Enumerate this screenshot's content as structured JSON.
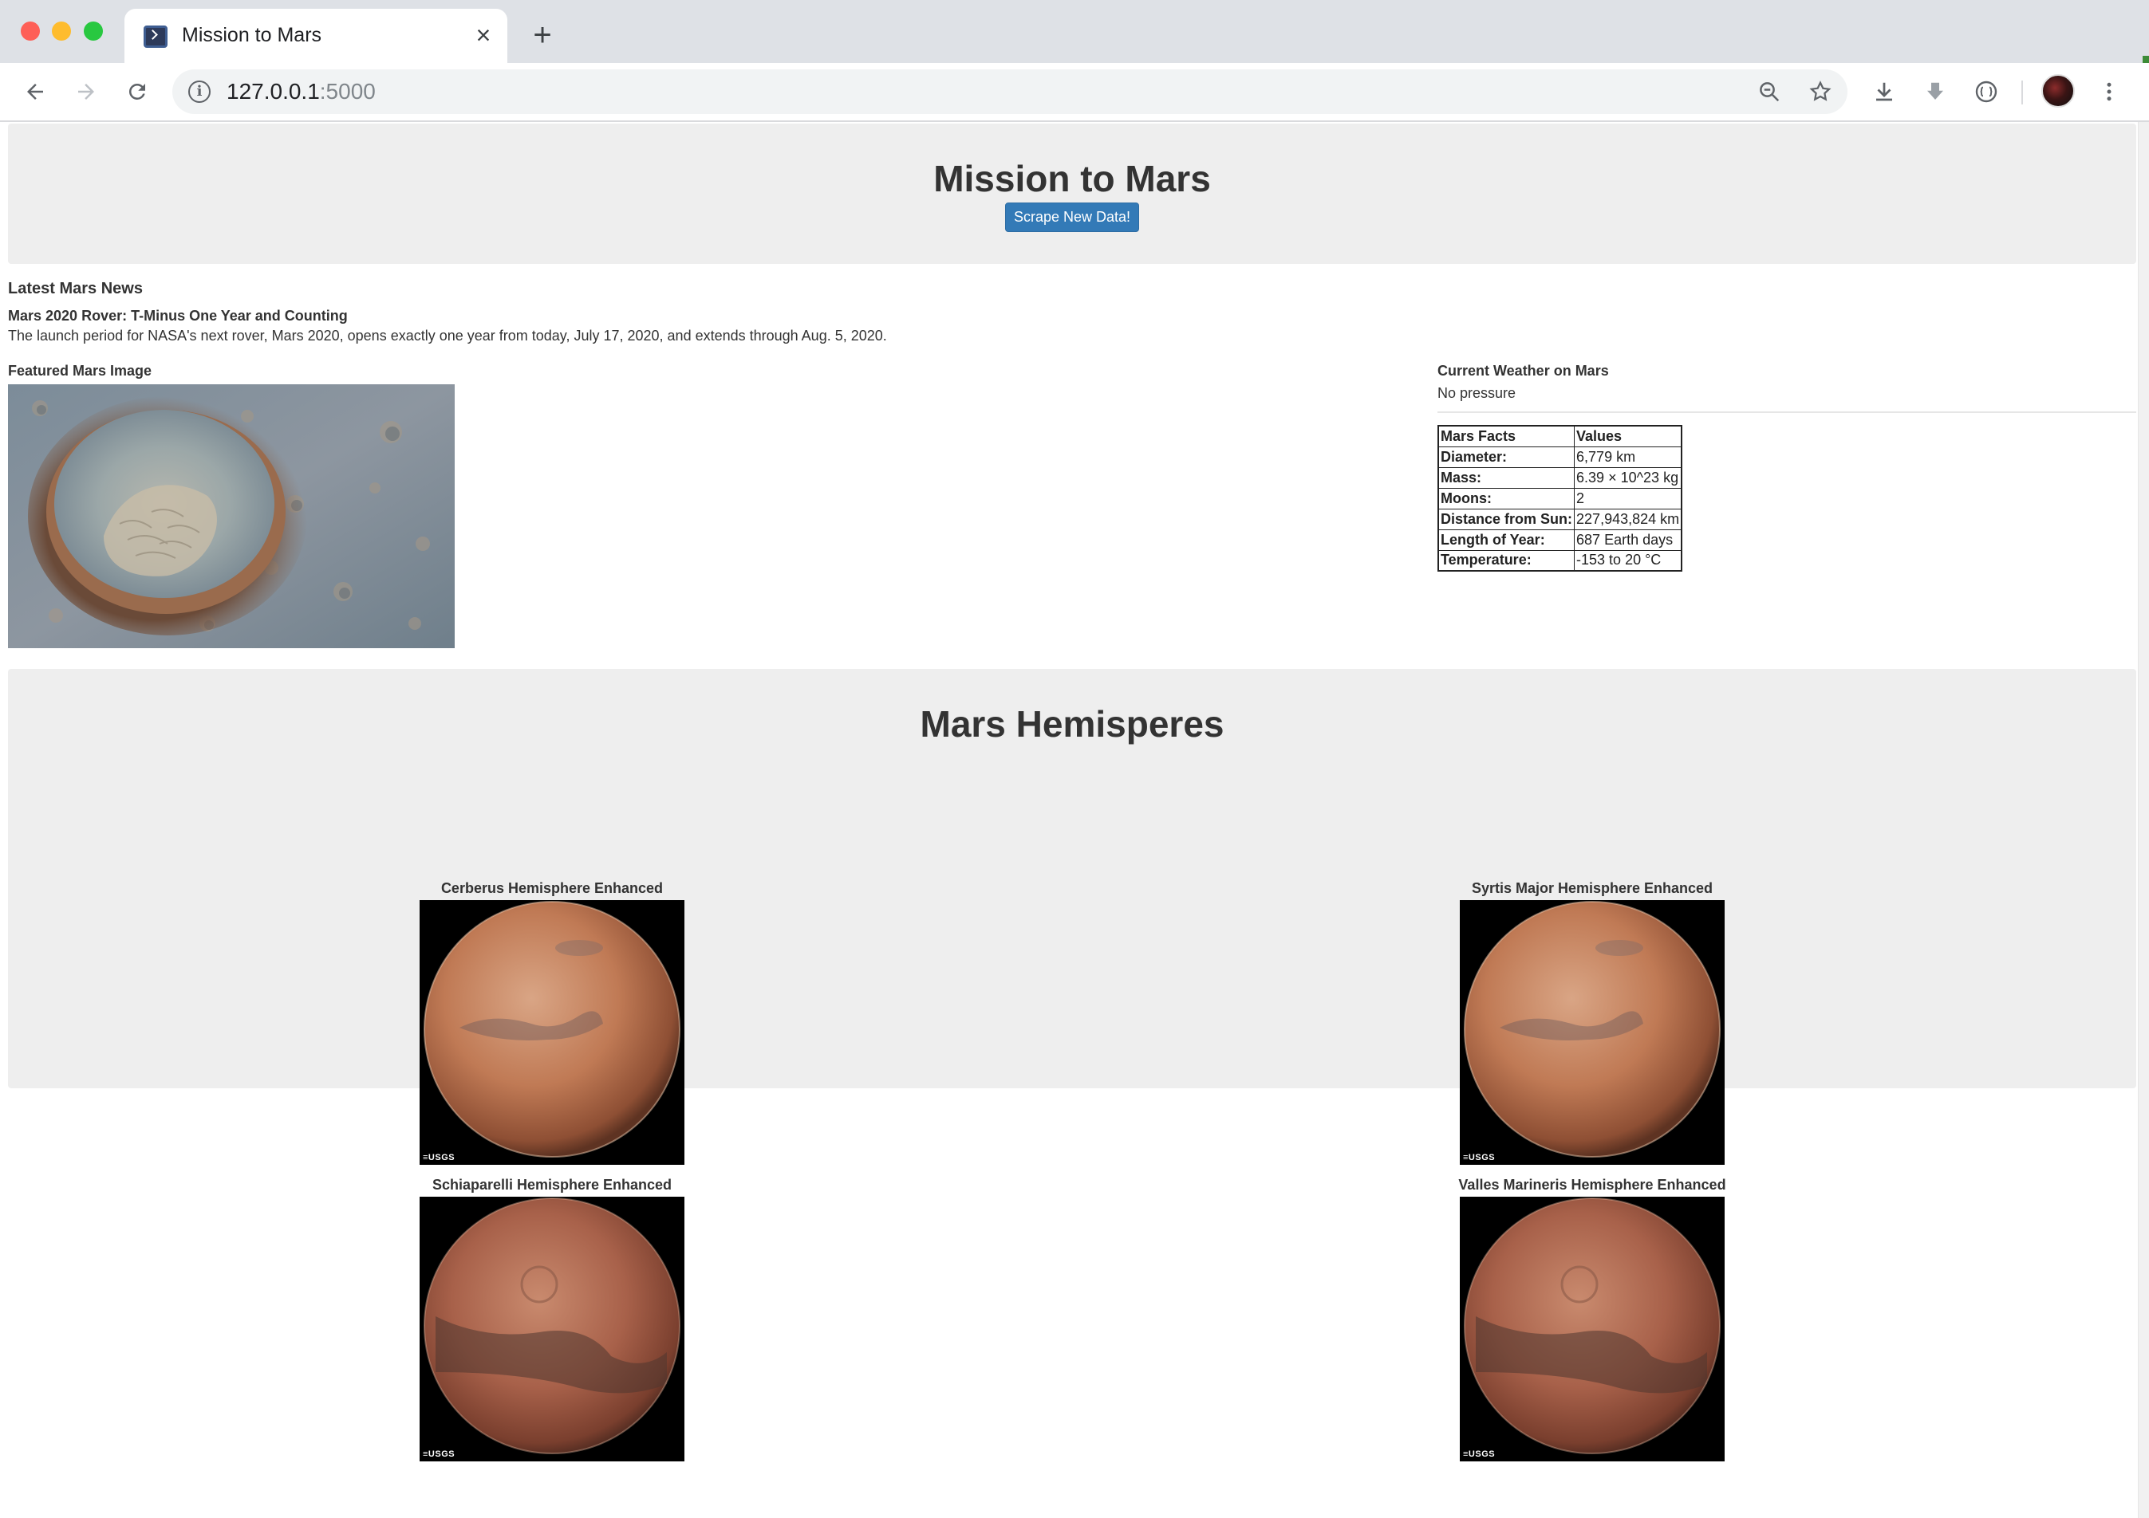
{
  "browser": {
    "tab_title": "Mission to Mars",
    "url_host": "127.0.0.1",
    "url_port": ":5000"
  },
  "header": {
    "title": "Mission to Mars",
    "scrape_button": "Scrape New Data!"
  },
  "news": {
    "heading": "Latest Mars News",
    "title": "Mars 2020 Rover: T-Minus One Year and Counting",
    "paragraph": "The launch period for NASA's next rover, Mars 2020, opens exactly one year from today, July 17, 2020, and extends through Aug. 5, 2020."
  },
  "featured": {
    "label": "Featured Mars Image"
  },
  "weather": {
    "label": "Current Weather on Mars",
    "text": "No pressure"
  },
  "facts": {
    "headers": [
      "Mars Facts",
      "Values"
    ],
    "rows": [
      [
        "Diameter:",
        "6,779 km"
      ],
      [
        "Mass:",
        "6.39 × 10^23 kg"
      ],
      [
        "Moons:",
        "2"
      ],
      [
        "Distance from Sun:",
        "227,943,824 km"
      ],
      [
        "Length of Year:",
        "687 Earth days"
      ],
      [
        "Temperature:",
        "-153 to 20 °C"
      ]
    ]
  },
  "hemispheres": {
    "title": "Mars Hemisperes",
    "items": [
      {
        "title": "Cerberus Hemisphere Enhanced",
        "usgs": "≡USGS"
      },
      {
        "title": "Syrtis Major Hemisphere Enhanced",
        "usgs": "≡USGS"
      },
      {
        "title": "Schiaparelli Hemisphere Enhanced",
        "usgs": "≡USGS"
      },
      {
        "title": "Valles Marineris Hemisphere Enhanced",
        "usgs": "≡USGS"
      }
    ]
  },
  "colors": {
    "button_primary": "#337ab7",
    "panel_bg": "#eeeeee"
  }
}
